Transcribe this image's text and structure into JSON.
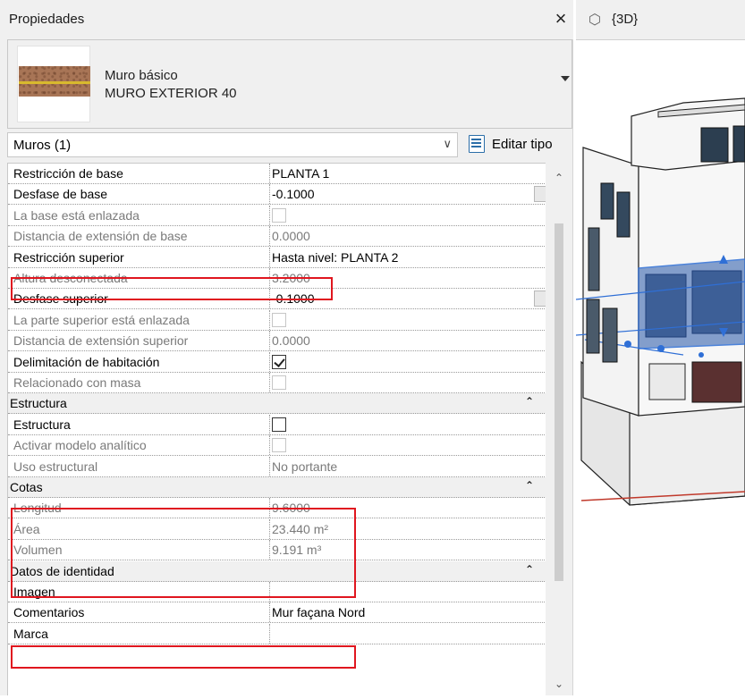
{
  "panel": {
    "title": "Propiedades",
    "close_glyph": "×",
    "type": {
      "family": "Muro básico",
      "name": "MURO EXTERIOR 40"
    },
    "filter": {
      "label": "Muros (1)",
      "chevron": "∨"
    },
    "edit_type_label": "Editar tipo",
    "rows": [
      {
        "name": "Restricción de base",
        "value": "PLANTA 1",
        "kind": "text",
        "enabled": true
      },
      {
        "name": "Desfase de base",
        "value": "-0.1000",
        "kind": "text",
        "enabled": true
      },
      {
        "name": "La base está enlazada",
        "value": "",
        "kind": "checkbox",
        "checked": false,
        "enabled": false
      },
      {
        "name": "Distancia de extensión de base",
        "value": "0.0000",
        "kind": "text",
        "enabled": false
      },
      {
        "name": "Restricción superior",
        "value": "Hasta nivel: PLANTA 2",
        "kind": "text",
        "enabled": true
      },
      {
        "name": "Altura desconectada",
        "value": "3.2000",
        "kind": "text",
        "enabled": false
      },
      {
        "name": "Desfase superior",
        "value": "-0.1000",
        "kind": "text",
        "enabled": true
      },
      {
        "name": "La parte superior está enlazada",
        "value": "",
        "kind": "checkbox",
        "checked": false,
        "enabled": false
      },
      {
        "name": "Distancia de extensión superior",
        "value": "0.0000",
        "kind": "text",
        "enabled": false
      },
      {
        "name": "Delimitación de habitación",
        "value": "",
        "kind": "checkbox",
        "checked": true,
        "enabled": true
      },
      {
        "name": "Relacionado con masa",
        "value": "",
        "kind": "checkbox",
        "checked": false,
        "enabled": false
      },
      {
        "name": "Estructura",
        "kind": "group",
        "chevron": "⌃"
      },
      {
        "name": "Estructura",
        "value": "",
        "kind": "checkbox",
        "checked": false,
        "enabled": true
      },
      {
        "name": "Activar modelo analítico",
        "value": "",
        "kind": "checkbox",
        "checked": false,
        "enabled": false
      },
      {
        "name": "Uso estructural",
        "value": "No portante",
        "kind": "text",
        "enabled": false
      },
      {
        "name": "Cotas",
        "kind": "group",
        "chevron": "⌃"
      },
      {
        "name": "Longitud",
        "value": "9.6000",
        "kind": "text",
        "enabled": false
      },
      {
        "name": "Área",
        "value": "23.440 m²",
        "kind": "text",
        "enabled": false
      },
      {
        "name": "Volumen",
        "value": "9.191 m³",
        "kind": "text",
        "enabled": false
      },
      {
        "name": "Datos de identidad",
        "kind": "group",
        "chevron": "⌃"
      },
      {
        "name": "Imagen",
        "value": "",
        "kind": "text",
        "enabled": true
      },
      {
        "name": "Comentarios",
        "value": "Mur façana Nord",
        "kind": "text",
        "enabled": true
      },
      {
        "name": "Marca",
        "value": "",
        "kind": "text",
        "enabled": true
      }
    ],
    "scroll": {
      "up": "⌃",
      "down": "⌄"
    }
  },
  "view": {
    "tab_label": "{3D}",
    "tab_icon": "cube-icon"
  },
  "colors": {
    "highlight": "#e0161f",
    "selection": "#2f6fd6",
    "wall_swatch": "#a87556"
  }
}
